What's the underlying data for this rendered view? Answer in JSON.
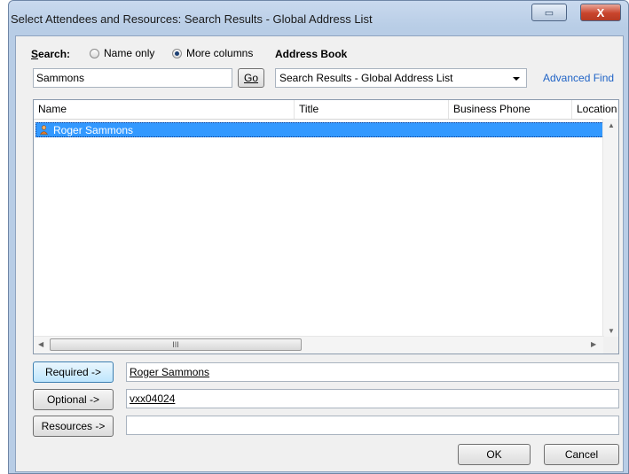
{
  "window": {
    "title": "Select Attendees and Resources: Search Results - Global Address List",
    "restore_glyph": "▭",
    "close_glyph": "X"
  },
  "search": {
    "label": "Search:",
    "option_name_only": "Name only",
    "option_more_columns": "More columns",
    "selected_option": "More columns",
    "value": "Sammons",
    "go_label": "Go"
  },
  "address_book": {
    "label": "Address Book",
    "selected": "Search Results - Global Address List",
    "advanced_find": "Advanced Find"
  },
  "list": {
    "columns": [
      "Name",
      "Title",
      "Business Phone",
      "Location"
    ],
    "rows": [
      {
        "name": "Roger Sammons",
        "icon": "contact-person-icon",
        "selected": true
      }
    ],
    "hscroll_grip": "III"
  },
  "recipients": {
    "required_label": "Required ->",
    "required_value": "Roger Sammons",
    "optional_label": "Optional ->",
    "optional_value": "vxx04024",
    "resources_label": "Resources ->",
    "resources_value": ""
  },
  "buttons": {
    "ok": "OK",
    "cancel": "Cancel"
  }
}
